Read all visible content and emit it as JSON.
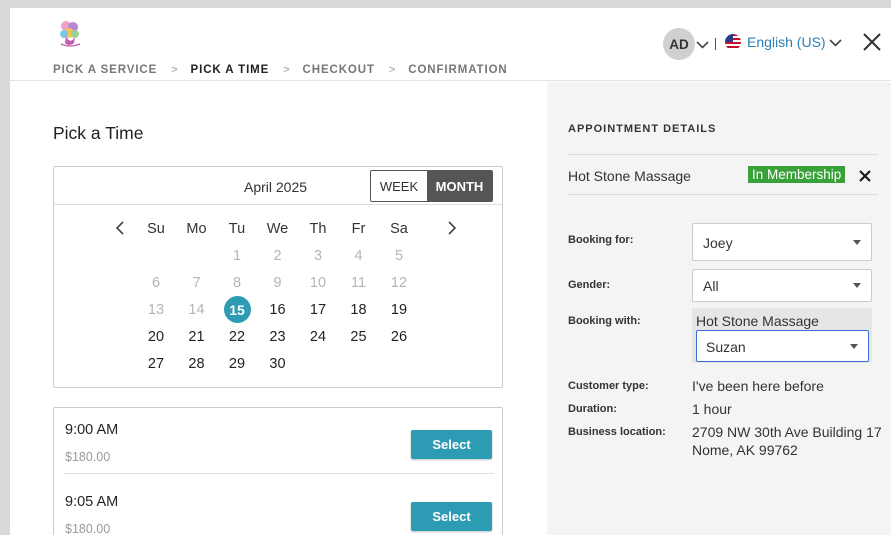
{
  "header": {
    "steps": [
      {
        "label": "PICK A SERVICE",
        "active": false
      },
      {
        "label": "PICK A TIME",
        "active": true
      },
      {
        "label": "CHECKOUT",
        "active": false
      },
      {
        "label": "CONFIRMATION",
        "active": false
      }
    ],
    "avatar_initials": "AD",
    "language": "English (US)"
  },
  "main": {
    "title": "Pick a Time",
    "calendar": {
      "month": "April 2025",
      "view_week": "WEEK",
      "view_month": "MONTH",
      "selected_view": "MONTH",
      "weekdays": [
        "Su",
        "Mo",
        "Tu",
        "We",
        "Th",
        "Fr",
        "Sa"
      ],
      "weeks": [
        [
          {
            "d": "",
            "s": "empty"
          },
          {
            "d": "",
            "s": "empty"
          },
          {
            "d": "1",
            "s": "muted"
          },
          {
            "d": "2",
            "s": "muted"
          },
          {
            "d": "3",
            "s": "muted"
          },
          {
            "d": "4",
            "s": "muted"
          },
          {
            "d": "5",
            "s": "muted"
          }
        ],
        [
          {
            "d": "6",
            "s": "muted"
          },
          {
            "d": "7",
            "s": "muted"
          },
          {
            "d": "8",
            "s": "muted"
          },
          {
            "d": "9",
            "s": "muted"
          },
          {
            "d": "10",
            "s": "muted"
          },
          {
            "d": "11",
            "s": "muted"
          },
          {
            "d": "12",
            "s": "muted"
          }
        ],
        [
          {
            "d": "13",
            "s": "muted"
          },
          {
            "d": "14",
            "s": "muted"
          },
          {
            "d": "15",
            "s": "selected"
          },
          {
            "d": "16",
            "s": "avail"
          },
          {
            "d": "17",
            "s": "avail"
          },
          {
            "d": "18",
            "s": "avail"
          },
          {
            "d": "19",
            "s": "avail"
          }
        ],
        [
          {
            "d": "20",
            "s": "avail"
          },
          {
            "d": "21",
            "s": "avail"
          },
          {
            "d": "22",
            "s": "avail"
          },
          {
            "d": "23",
            "s": "avail"
          },
          {
            "d": "24",
            "s": "avail"
          },
          {
            "d": "25",
            "s": "avail"
          },
          {
            "d": "26",
            "s": "avail"
          }
        ],
        [
          {
            "d": "27",
            "s": "avail"
          },
          {
            "d": "28",
            "s": "avail"
          },
          {
            "d": "29",
            "s": "avail"
          },
          {
            "d": "30",
            "s": "avail"
          },
          {
            "d": "",
            "s": "empty"
          },
          {
            "d": "",
            "s": "empty"
          },
          {
            "d": "",
            "s": "empty"
          }
        ]
      ]
    },
    "slots": [
      {
        "time": "9:00 AM",
        "price": "$180.00",
        "button": "Select"
      },
      {
        "time": "9:05 AM",
        "price": "$180.00",
        "button": "Select"
      }
    ]
  },
  "details": {
    "title": "APPOINTMENT DETAILS",
    "service": "Hot Stone Massage",
    "badge": "In Membership",
    "booking_for_label": "Booking for:",
    "booking_for_value": "Joey",
    "gender_label": "Gender:",
    "gender_value": "All",
    "booking_with_label": "Booking with:",
    "booking_with_group": "Hot Stone Massage",
    "booking_with_value": "Suzan",
    "customer_type_label": "Customer type:",
    "customer_type_value": "I've been here before",
    "duration_label": "Duration:",
    "duration_value": "1 hour",
    "location_label": "Business location:",
    "location_line1": "2709 NW 30th Ave Building 17",
    "location_line2": "Nome, AK 99762"
  },
  "colors": {
    "accent": "#2e9bb4",
    "badge": "#3aa13a",
    "link": "#2c7fb8",
    "panel": "#f4f4f4"
  },
  "icons": {
    "logo": "brand-logo",
    "close": "close-icon",
    "flag": "us-flag-icon",
    "prev": "chevron-left-icon",
    "next": "chevron-right-icon"
  }
}
